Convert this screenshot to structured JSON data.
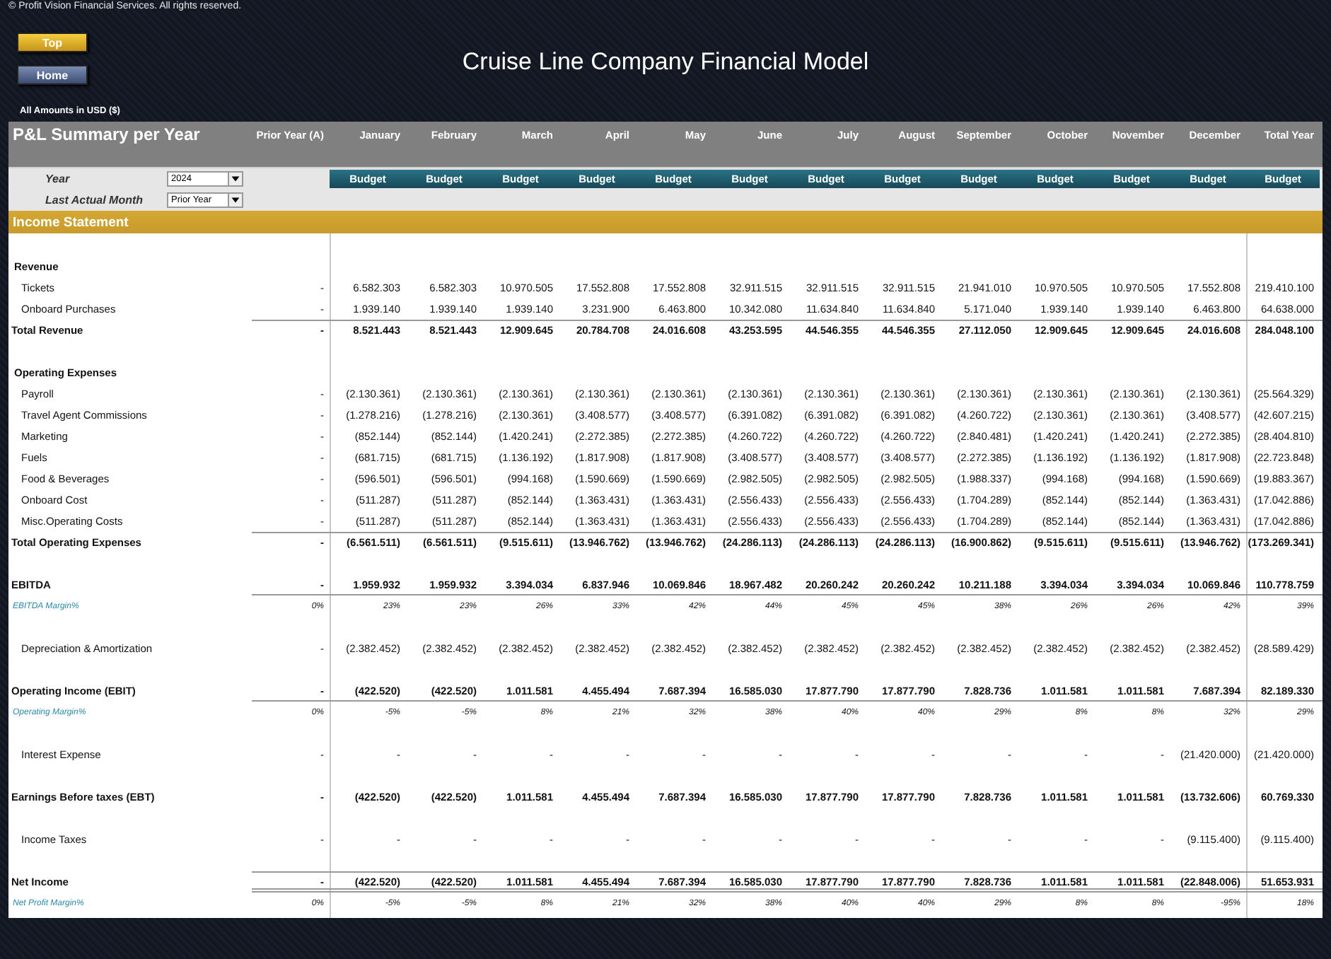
{
  "copyright": "© Profit Vision Financial Services. All rights reserved.",
  "nav_buttons": [
    {
      "label": "Top",
      "kind": "gold"
    },
    {
      "label": "Home",
      "kind": "blue"
    }
  ],
  "title": "Cruise Line Company Financial Model",
  "currency_note": "All Amounts in  USD ($)",
  "summary_title": "P&L Summary per Year",
  "columns": [
    "Prior Year (A)",
    "January",
    "February",
    "March",
    "April",
    "May",
    "June",
    "July",
    "August",
    "September",
    "October",
    "November",
    "December",
    "Total Year"
  ],
  "scenarios": [
    "Budget",
    "Budget",
    "Budget",
    "Budget",
    "Budget",
    "Budget",
    "Budget",
    "Budget",
    "Budget",
    "Budget",
    "Budget",
    "Budget",
    "Budget"
  ],
  "controls": [
    {
      "label": "Year",
      "value": "2024"
    },
    {
      "label": "Last Actual Month",
      "value": "Prior Year"
    }
  ],
  "section_title": "Income Statement",
  "rows": [
    {
      "label": "Revenue",
      "kind": "heading"
    },
    {
      "label": "Tickets",
      "kind": "item",
      "values": [
        "-",
        "6.582.303",
        "6.582.303",
        "10.970.505",
        "17.552.808",
        "17.552.808",
        "32.911.515",
        "32.911.515",
        "32.911.515",
        "21.941.010",
        "10.970.505",
        "10.970.505",
        "17.552.808",
        "219.410.100"
      ]
    },
    {
      "label": "Onboard Purchases",
      "kind": "item",
      "values": [
        "-",
        "1.939.140",
        "1.939.140",
        "1.939.140",
        "3.231.900",
        "6.463.800",
        "10.342.080",
        "11.634.840",
        "11.634.840",
        "5.171.040",
        "1.939.140",
        "1.939.140",
        "6.463.800",
        "64.638.000"
      ]
    },
    {
      "label": "Total Revenue",
      "kind": "total",
      "values": [
        "-",
        "8.521.443",
        "8.521.443",
        "12.909.645",
        "20.784.708",
        "24.016.608",
        "43.253.595",
        "44.546.355",
        "44.546.355",
        "27.112.050",
        "12.909.645",
        "12.909.645",
        "24.016.608",
        "284.048.100"
      ]
    },
    {
      "label": "Operating Expenses",
      "kind": "heading"
    },
    {
      "label": "Payroll",
      "kind": "item",
      "values": [
        "-",
        "(2.130.361)",
        "(2.130.361)",
        "(2.130.361)",
        "(2.130.361)",
        "(2.130.361)",
        "(2.130.361)",
        "(2.130.361)",
        "(2.130.361)",
        "(2.130.361)",
        "(2.130.361)",
        "(2.130.361)",
        "(2.130.361)",
        "(25.564.329)"
      ]
    },
    {
      "label": "Travel Agent Commissions",
      "kind": "item",
      "values": [
        "-",
        "(1.278.216)",
        "(1.278.216)",
        "(2.130.361)",
        "(3.408.577)",
        "(3.408.577)",
        "(6.391.082)",
        "(6.391.082)",
        "(6.391.082)",
        "(4.260.722)",
        "(2.130.361)",
        "(2.130.361)",
        "(3.408.577)",
        "(42.607.215)"
      ]
    },
    {
      "label": "Marketing",
      "kind": "item",
      "values": [
        "-",
        "(852.144)",
        "(852.144)",
        "(1.420.241)",
        "(2.272.385)",
        "(2.272.385)",
        "(4.260.722)",
        "(4.260.722)",
        "(4.260.722)",
        "(2.840.481)",
        "(1.420.241)",
        "(1.420.241)",
        "(2.272.385)",
        "(28.404.810)"
      ]
    },
    {
      "label": "Fuels",
      "kind": "item",
      "values": [
        "-",
        "(681.715)",
        "(681.715)",
        "(1.136.192)",
        "(1.817.908)",
        "(1.817.908)",
        "(3.408.577)",
        "(3.408.577)",
        "(3.408.577)",
        "(2.272.385)",
        "(1.136.192)",
        "(1.136.192)",
        "(1.817.908)",
        "(22.723.848)"
      ]
    },
    {
      "label": "Food & Beverages",
      "kind": "item",
      "values": [
        "-",
        "(596.501)",
        "(596.501)",
        "(994.168)",
        "(1.590.669)",
        "(1.590.669)",
        "(2.982.505)",
        "(2.982.505)",
        "(2.982.505)",
        "(1.988.337)",
        "(994.168)",
        "(994.168)",
        "(1.590.669)",
        "(19.883.367)"
      ]
    },
    {
      "label": "Onboard Cost",
      "kind": "item",
      "values": [
        "-",
        "(511.287)",
        "(511.287)",
        "(852.144)",
        "(1.363.431)",
        "(1.363.431)",
        "(2.556.433)",
        "(2.556.433)",
        "(2.556.433)",
        "(1.704.289)",
        "(852.144)",
        "(852.144)",
        "(1.363.431)",
        "(17.042.886)"
      ]
    },
    {
      "label": "Misc.Operating Costs",
      "kind": "item",
      "values": [
        "-",
        "(511.287)",
        "(511.287)",
        "(852.144)",
        "(1.363.431)",
        "(1.363.431)",
        "(2.556.433)",
        "(2.556.433)",
        "(2.556.433)",
        "(1.704.289)",
        "(852.144)",
        "(852.144)",
        "(1.363.431)",
        "(17.042.886)"
      ]
    },
    {
      "label": "Total Operating Expenses",
      "kind": "total",
      "values": [
        "-",
        "(6.561.511)",
        "(6.561.511)",
        "(9.515.611)",
        "(13.946.762)",
        "(13.946.762)",
        "(24.286.113)",
        "(24.286.113)",
        "(24.286.113)",
        "(16.900.862)",
        "(9.515.611)",
        "(9.515.611)",
        "(13.946.762)",
        "(173.269.341)"
      ]
    },
    {
      "label": "EBITDA",
      "kind": "major",
      "values": [
        "-",
        "1.959.932",
        "1.959.932",
        "3.394.034",
        "6.837.946",
        "10.069.846",
        "18.967.482",
        "20.260.242",
        "20.260.242",
        "10.211.188",
        "3.394.034",
        "3.394.034",
        "10.069.846",
        "110.778.759"
      ]
    },
    {
      "label": "EBITDA Margin%",
      "kind": "margin",
      "values": [
        "0%",
        "23%",
        "23%",
        "26%",
        "33%",
        "42%",
        "44%",
        "45%",
        "45%",
        "38%",
        "26%",
        "26%",
        "42%",
        "39%"
      ]
    },
    {
      "label": "Depreciation & Amortization",
      "kind": "standalone",
      "values": [
        "-",
        "(2.382.452)",
        "(2.382.452)",
        "(2.382.452)",
        "(2.382.452)",
        "(2.382.452)",
        "(2.382.452)",
        "(2.382.452)",
        "(2.382.452)",
        "(2.382.452)",
        "(2.382.452)",
        "(2.382.452)",
        "(2.382.452)",
        "(28.589.429)"
      ]
    },
    {
      "label": "Operating Income (EBIT)",
      "kind": "major",
      "values": [
        "-",
        "(422.520)",
        "(422.520)",
        "1.011.581",
        "4.455.494",
        "7.687.394",
        "16.585.030",
        "17.877.790",
        "17.877.790",
        "7.828.736",
        "1.011.581",
        "1.011.581",
        "7.687.394",
        "82.189.330"
      ]
    },
    {
      "label": "Operating Margin%",
      "kind": "margin",
      "values": [
        "0%",
        "-5%",
        "-5%",
        "8%",
        "21%",
        "32%",
        "38%",
        "40%",
        "40%",
        "29%",
        "8%",
        "8%",
        "32%",
        "29%"
      ]
    },
    {
      "label": "Interest Expense",
      "kind": "standalone",
      "values": [
        "-",
        "-",
        "-",
        "-",
        "-",
        "-",
        "-",
        "-",
        "-",
        "-",
        "-",
        "-",
        "(21.420.000)",
        "(21.420.000)"
      ]
    },
    {
      "label": "Earnings Before taxes (EBT)",
      "kind": "major",
      "values": [
        "-",
        "(422.520)",
        "(422.520)",
        "1.011.581",
        "4.455.494",
        "7.687.394",
        "16.585.030",
        "17.877.790",
        "17.877.790",
        "7.828.736",
        "1.011.581",
        "1.011.581",
        "(13.732.606)",
        "60.769.330"
      ]
    },
    {
      "label": "Income Taxes",
      "kind": "standalone",
      "values": [
        "-",
        "-",
        "-",
        "-",
        "-",
        "-",
        "-",
        "-",
        "-",
        "-",
        "-",
        "-",
        "(9.115.400)",
        "(9.115.400)"
      ]
    },
    {
      "label": "Net Income",
      "kind": "net",
      "values": [
        "-",
        "(422.520)",
        "(422.520)",
        "1.011.581",
        "4.455.494",
        "7.687.394",
        "16.585.030",
        "17.877.790",
        "17.877.790",
        "7.828.736",
        "1.011.581",
        "1.011.581",
        "(22.848.006)",
        "51.653.931"
      ]
    },
    {
      "label": "Net Profit Margin%",
      "kind": "margin",
      "values": [
        "0%",
        "-5%",
        "-5%",
        "8%",
        "21%",
        "32%",
        "38%",
        "40%",
        "40%",
        "29%",
        "8%",
        "8%",
        "-95%",
        "18%"
      ]
    }
  ]
}
